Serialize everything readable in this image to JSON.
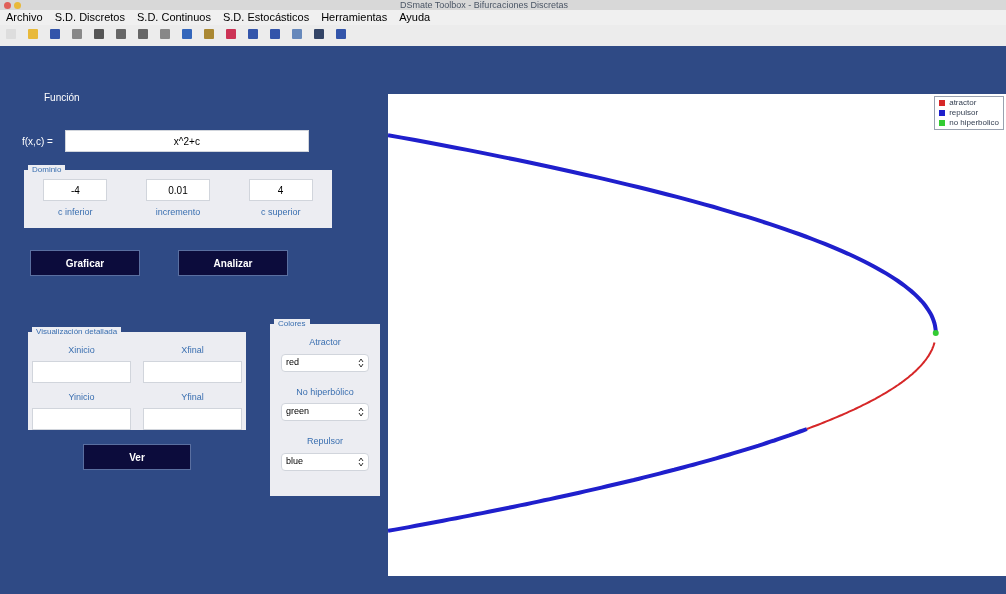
{
  "window": {
    "title": "DSmate Toolbox - Bifurcaciones Discretas"
  },
  "menu": [
    "Archivo",
    "S.D. Discretos",
    "S.D. Continuos",
    "S.D. Estocásticos",
    "Herramientas",
    "Ayuda"
  ],
  "function": {
    "title": "Función",
    "label": "f(x,c) =",
    "value": "x^2+c"
  },
  "domain": {
    "title": "Dominio",
    "fields": [
      {
        "value": "-4",
        "label": "c inferior"
      },
      {
        "value": "0.01",
        "label": "incremento"
      },
      {
        "value": "4",
        "label": "c superior"
      }
    ]
  },
  "actions": [
    "Graficar",
    "Analizar"
  ],
  "detail": {
    "title": "Visualización detallada",
    "fields": [
      "Xinicio",
      "Xfinal",
      "Yinicio",
      "Yfinal"
    ],
    "button": "Ver"
  },
  "colors": {
    "title": "Colores",
    "selects": [
      {
        "label": "Atractor",
        "value": "red"
      },
      {
        "label": "No hiperbólico",
        "value": "green"
      },
      {
        "label": "Repulsor",
        "value": "blue"
      }
    ]
  },
  "plot": {
    "legend": [
      {
        "label": "atractor",
        "color": "#d62728"
      },
      {
        "label": "repulsor",
        "color": "#1f1fcc"
      },
      {
        "label": "no hiperbolico",
        "color": "#33cc33"
      }
    ]
  }
}
